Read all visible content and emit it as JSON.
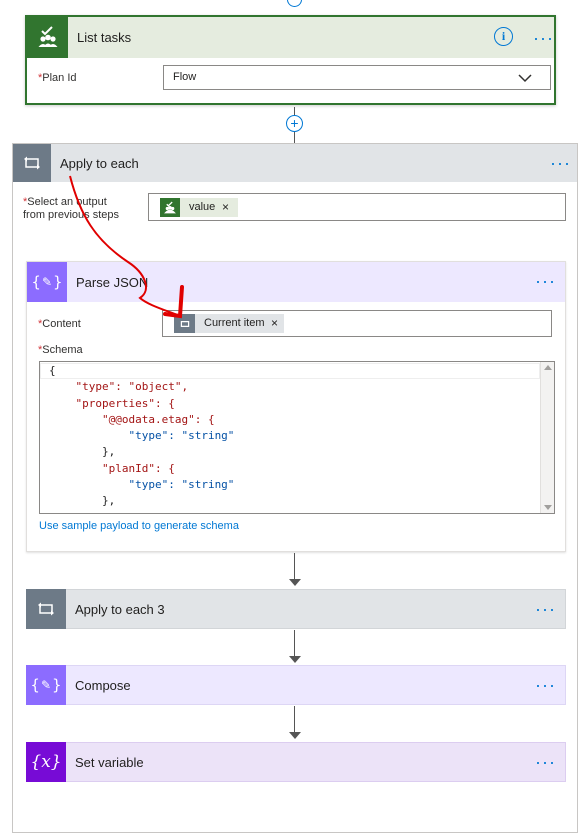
{
  "list_tasks": {
    "title": "List tasks",
    "field_label": "Plan Id",
    "field_value": "Flow",
    "more_label": "···"
  },
  "apply_each": {
    "title": "Apply to each",
    "select_label_1": "Select an output",
    "select_label_2": "from previous steps",
    "token_label": "value",
    "token_remove": "×",
    "more_label": "···"
  },
  "parse_json": {
    "title": "Parse JSON",
    "content_label": "Content",
    "content_token": "Current item",
    "content_token_remove": "×",
    "schema_label": "Schema",
    "schema_lines": [
      "{",
      "    \"type\": \"object\",",
      "    \"properties\": {",
      "        \"@@odata.etag\": {",
      "            \"type\": \"string\"",
      "        },",
      "        \"planId\": {",
      "            \"type\": \"string\"",
      "        },"
    ],
    "sample_link": "Use sample payload to generate schema",
    "more_label": "···"
  },
  "apply_each_3": {
    "title": "Apply to each 3",
    "more_label": "···"
  },
  "compose": {
    "title": "Compose",
    "more_label": "···"
  },
  "set_variable": {
    "title": "Set variable",
    "icon_text": "{x}",
    "more_label": "···"
  },
  "required_mark": "*",
  "colors": {
    "planner_green": "#31752f",
    "apply_gray": "#6d7a87",
    "data_ops_purple": "#8c6cff",
    "variable_purple": "#770bd6",
    "link_blue": "#0078d4",
    "annotation_red": "#e00000"
  }
}
